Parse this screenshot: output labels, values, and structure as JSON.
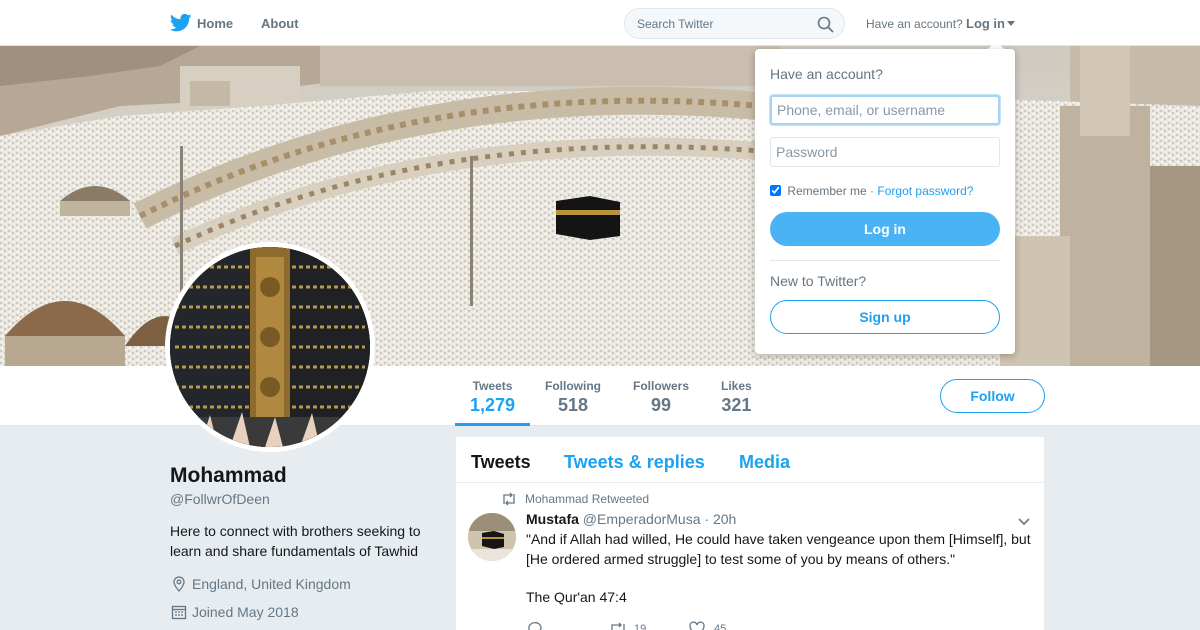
{
  "nav": {
    "logo_icon": "twitter-bird-icon",
    "home": "Home",
    "about": "About",
    "search_placeholder": "Search Twitter",
    "have_account": "Have an account?",
    "login": "Log in"
  },
  "profile": {
    "name": "Mohammad",
    "handle": "@FollwrOfDeen",
    "bio": "Here to connect with brothers seeking to learn and share fundamentals of Tawhid",
    "location": "England, United Kingdom",
    "joined": "Joined May 2018"
  },
  "stats": [
    {
      "label": "Tweets",
      "value": "1,279"
    },
    {
      "label": "Following",
      "value": "518"
    },
    {
      "label": "Followers",
      "value": "99"
    },
    {
      "label": "Likes",
      "value": "321"
    }
  ],
  "follow_label": "Follow",
  "timeline": {
    "tabs": [
      "Tweets",
      "Tweets & replies",
      "Media"
    ],
    "tweet": {
      "context": "Mohammad Retweeted",
      "fullname": "Mustafa",
      "username": "@EmperadorMusa",
      "time": "· 20h",
      "text": "\"And if Allah had willed, He could have taken vengeance upon them [Himself], but [He ordered armed struggle] to test some of you by means of others.\"",
      "reference": "The Qur'an 47:4",
      "retweets": "19",
      "likes": "45"
    }
  },
  "login_dropdown": {
    "title": "Have an account?",
    "username_placeholder": "Phone, email, or username",
    "password_placeholder": "Password",
    "remember": "Remember me",
    "separator": "·",
    "forgot": "Forgot password?",
    "login_button": "Log in",
    "new_to": "New to Twitter?",
    "signup_button": "Sign up"
  },
  "colors": {
    "accent": "#1da1f2",
    "background": "#e6ecf0",
    "login_button": "#4ab3f4"
  }
}
